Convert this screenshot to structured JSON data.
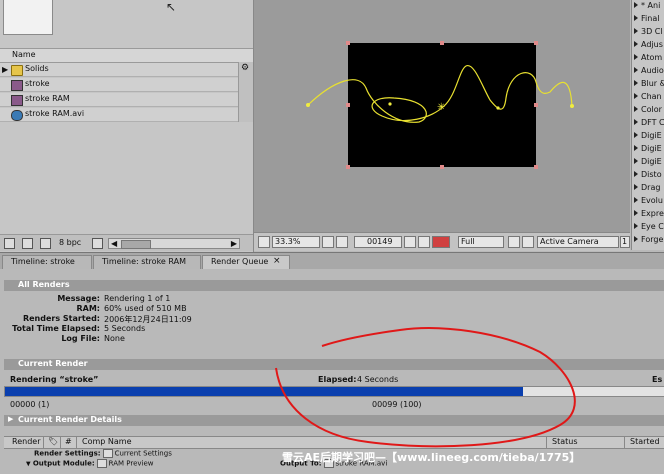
{
  "project": {
    "column_name": "Name",
    "items": [
      {
        "label": "Solids",
        "type": "folder"
      },
      {
        "label": "stroke",
        "type": "composition"
      },
      {
        "label": "stroke RAM",
        "type": "composition"
      },
      {
        "label": "stroke RAM.avi",
        "type": "footage"
      }
    ],
    "bpc": "8 bpc"
  },
  "viewer": {
    "zoom": "33.3%",
    "timecode": "00149",
    "resolution": "Full",
    "camera": "Active Camera",
    "views": "1"
  },
  "effects": [
    "* Ani",
    "Final",
    "3D Cl",
    "Adjus",
    "Atom",
    "Audio",
    "Blur &",
    "Chan",
    "Color",
    "DFT C",
    "DigiE",
    "DigiE",
    "DigiE",
    "Disto",
    "Drag",
    "Evolu",
    "Expre",
    "Eye C",
    "Forge"
  ],
  "tabs": [
    {
      "label": "Timeline: stroke"
    },
    {
      "label": "Timeline: stroke RAM"
    },
    {
      "label": "Render Queue",
      "active": true,
      "close": "×"
    }
  ],
  "render_queue": {
    "all_renders_title": "All Renders",
    "message_label": "Message:",
    "message": "Rendering 1 of 1",
    "ram_label": "RAM:",
    "ram": "60% used of 510 MB",
    "started_label": "Renders Started:",
    "started": "2006年12月24日11:09",
    "elapsed_label": "Total Time Elapsed:",
    "elapsed": "5 Seconds",
    "log_label": "Log File:",
    "log": "None",
    "current_render_title": "Current Render",
    "rendering": "Rendering “stroke”",
    "cur_elapsed_label": "Elapsed:",
    "cur_elapsed": "4 Seconds",
    "est_label": "Es",
    "progress": 0.785,
    "start_frame": "00000 (1)",
    "current_frame": "00099 (100)",
    "details_title": "Current Render Details",
    "columns": {
      "render": "Render",
      "hash": "#",
      "comp_name": "Comp Name",
      "status": "Status",
      "started": "Started"
    },
    "render_settings_label": "Render Settings:",
    "render_settings": "Current Settings",
    "output_module_label": "Output Module:",
    "output_module": "RAM Preview",
    "output_to_label": "Output To:",
    "output_to": "stroke RAM.avi"
  },
  "watermark": "雪云AE后期学习吧—【www.lineeg.com/tieba/1775】",
  "colors": {
    "progress": "#0a3fae",
    "annotation": "#e01818",
    "spline": "#e8e030"
  }
}
